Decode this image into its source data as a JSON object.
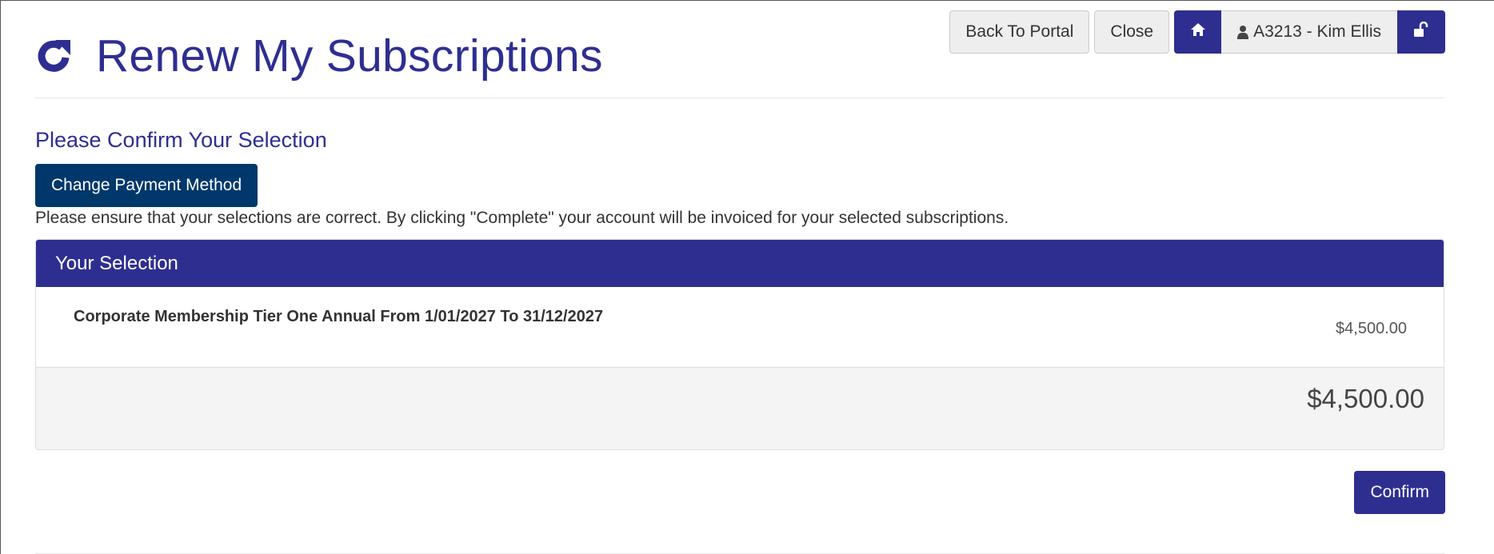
{
  "header": {
    "title": "Renew My Subscriptions",
    "icon": "refresh-icon"
  },
  "topbar": {
    "back_to_portal": "Back To Portal",
    "close": "Close",
    "home_icon": "home-icon",
    "user_icon": "user-icon",
    "user_label": "A3213 - Kim Ellis",
    "logout_icon": "unlock-icon"
  },
  "main": {
    "subheading": "Please Confirm Your Selection",
    "change_payment_label": "Change Payment Method",
    "info_text": "Please ensure that your selections are correct. By clicking \"Complete\" your account will be invoiced for your selected subscriptions.",
    "panel": {
      "heading": "Your Selection",
      "items": [
        {
          "description": "Corporate Membership Tier One Annual From 1/01/2027 To 31/12/2027",
          "price": "$4,500.00"
        }
      ],
      "total": "$4,500.00"
    },
    "confirm_label": "Confirm"
  },
  "colors": {
    "brand": "#2e2e91",
    "dark_button": "#00386b"
  }
}
